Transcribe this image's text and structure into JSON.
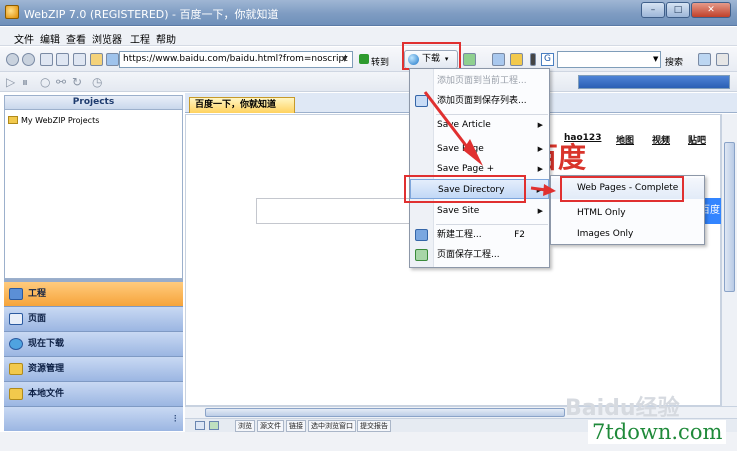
{
  "window": {
    "title": "WebZIP 7.0 (REGISTERED) - 百度一下，你就知道",
    "controls": {
      "minimize": "–",
      "maximize": "□",
      "close": "✕"
    }
  },
  "menubar": [
    "文件",
    "编辑",
    "查看",
    "浏览器",
    "工程",
    "帮助"
  ],
  "toolbar": {
    "url": "https://www.baidu.com/baidu.html?from=noscript",
    "goto_label": "转到",
    "download_label": "下载",
    "search_label": "搜索",
    "search_engine_icon": "G"
  },
  "sidebar": {
    "header": "Projects",
    "projects": [
      "My WebZIP Projects"
    ],
    "groups": [
      {
        "label": "工程",
        "icon": "project-icon",
        "active": true
      },
      {
        "label": "页面",
        "icon": "page-icon",
        "active": false
      },
      {
        "label": "现在下载",
        "icon": "globe-icon",
        "active": false
      },
      {
        "label": "资源管理",
        "icon": "explorer-icon",
        "active": false
      },
      {
        "label": "本地文件",
        "icon": "folder-icon",
        "active": false
      }
    ]
  },
  "browser": {
    "tab_label": "百度一下，你就知道",
    "nav_links": [
      "hao123",
      "地图",
      "视频",
      "贴吧"
    ],
    "logo_text": "百度",
    "search_button_label": "百度一"
  },
  "download_menu": {
    "items": [
      {
        "label": "添加页面到当前工程...",
        "disabled": true,
        "submenu": false
      },
      {
        "label": "添加页面到保存列表...",
        "disabled": false,
        "submenu": false,
        "icon": "add-page-icon"
      },
      {
        "label": "Save Article",
        "disabled": false,
        "submenu": true
      },
      {
        "label": "Save Page",
        "disabled": false,
        "submenu": true
      },
      {
        "label": "Save Page +",
        "disabled": false,
        "submenu": true
      },
      {
        "label": "Save Directory",
        "disabled": false,
        "submenu": true,
        "highlighted": true
      },
      {
        "label": "Save Site",
        "disabled": false,
        "submenu": true
      },
      {
        "label": "新建工程...",
        "shortcut": "F2",
        "disabled": false,
        "submenu": false,
        "icon": "new-project-icon"
      },
      {
        "label": "页面保存工程...",
        "disabled": false,
        "submenu": false,
        "icon": "save-project-icon"
      }
    ]
  },
  "directory_submenu": {
    "items": [
      "Web Pages - Complete",
      "HTML Only",
      "Images Only"
    ]
  },
  "statusbar": {
    "labels": [
      "浏览",
      "源文件",
      "链接",
      "选中浏览窗口",
      "提交报告"
    ]
  },
  "watermarks": {
    "baidu": "Baidu经验",
    "site": "7tdown.com"
  },
  "colors": {
    "annotation_red": "#e03030",
    "active_group": "#f6a43b",
    "baidu_red": "#d9342b",
    "baidu_blue": "#3385ff"
  }
}
